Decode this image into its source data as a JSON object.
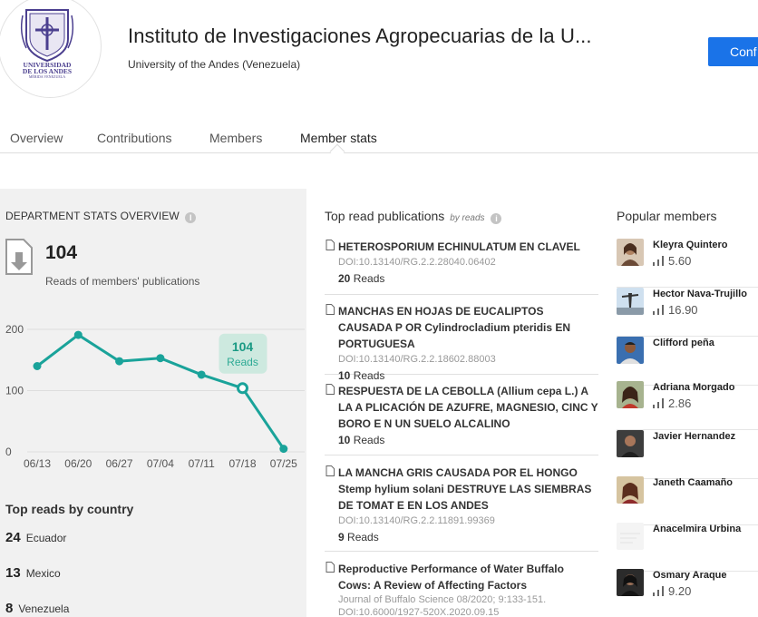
{
  "header": {
    "institution_name": "Instituto de Investigaciones Agropecuarias de la U...",
    "university": "University of the Andes (Venezuela)",
    "confirm_label": "Conf",
    "logo_text_line1": "UNIVERSIDAD",
    "logo_text_line2": "DE LOS ANDES",
    "logo_text_line3": "MÉRIDA VENEZUELA"
  },
  "tabs": [
    {
      "label": "Overview"
    },
    {
      "label": "Contributions"
    },
    {
      "label": "Members"
    },
    {
      "label": "Member stats",
      "active": true
    }
  ],
  "stats": {
    "title": "DEPARTMENT STATS OVERVIEW",
    "info_glyph": "i",
    "total_reads": "104",
    "reads_caption": "Reads of members' publications"
  },
  "chart_data": {
    "type": "line",
    "categories": [
      "06/13",
      "06/20",
      "06/27",
      "07/04",
      "07/11",
      "07/18",
      "07/25"
    ],
    "values": [
      140,
      191,
      148,
      153,
      126,
      104,
      5
    ],
    "yticks": [
      0,
      100,
      200
    ],
    "ylim": [
      0,
      200
    ],
    "highlight": {
      "index": 5,
      "value": "104",
      "label": "Reads"
    },
    "color": "#1aa39a"
  },
  "countries": {
    "title": "Top reads by country",
    "items": [
      {
        "count": "24",
        "name": "Ecuador"
      },
      {
        "count": "13",
        "name": "Mexico"
      },
      {
        "count": "8",
        "name": "Venezuela"
      }
    ]
  },
  "publications": {
    "title": "Top read publications",
    "subtitle": "by reads",
    "items": [
      {
        "title": "HETEROSPORIUM ECHINULATUM EN CLAVEL",
        "meta": "DOI:10.13140/RG.2.2.28040.06402",
        "reads": "20",
        "reads_label": "Reads"
      },
      {
        "title": "MANCHAS EN HOJAS DE EUCALIPTOS CAUSADA P OR Cylindrocladium pteridis EN PORTUGUESA",
        "meta": "DOI:10.13140/RG.2.2.18602.88003",
        "reads": "10",
        "reads_label": "Reads"
      },
      {
        "title": "RESPUESTA DE LA CEBOLLA (Allium cepa L.) A LA A PLICACIÓN DE AZUFRE, MAGNESIO, CINC Y BORO E N UN SUELO ALCALINO",
        "meta": "",
        "reads": "10",
        "reads_label": "Reads"
      },
      {
        "title": "LA MANCHA GRIS CAUSADA POR EL HONGO Stemp hylium solani DESTRUYE LAS SIEMBRAS DE TOMAT E EN LOS ANDES",
        "meta": "DOI:10.13140/RG.2.2.11891.99369",
        "reads": "9",
        "reads_label": "Reads"
      },
      {
        "title": "Reproductive Performance of Water Buffalo Cows: A Review of Affecting Factors",
        "meta": "Journal of Buffalo Science 08/2020; 9:133-151. DOI:10.6000/1927-520X.2020.09.15",
        "reads": "",
        "reads_label": ""
      }
    ]
  },
  "members": {
    "title": "Popular members",
    "items": [
      {
        "name": "Kleyra Quintero",
        "score": "5.60"
      },
      {
        "name": "Hector Nava-Trujillo",
        "score": "16.90"
      },
      {
        "name": "Clifford peña",
        "score": ""
      },
      {
        "name": "Adriana Morgado",
        "score": "2.86"
      },
      {
        "name": "Javier Hernandez",
        "score": ""
      },
      {
        "name": "Janeth Caamaño",
        "score": ""
      },
      {
        "name": "Anacelmira Urbina",
        "score": ""
      },
      {
        "name": "Osmary Araque",
        "score": "9.20"
      }
    ]
  }
}
